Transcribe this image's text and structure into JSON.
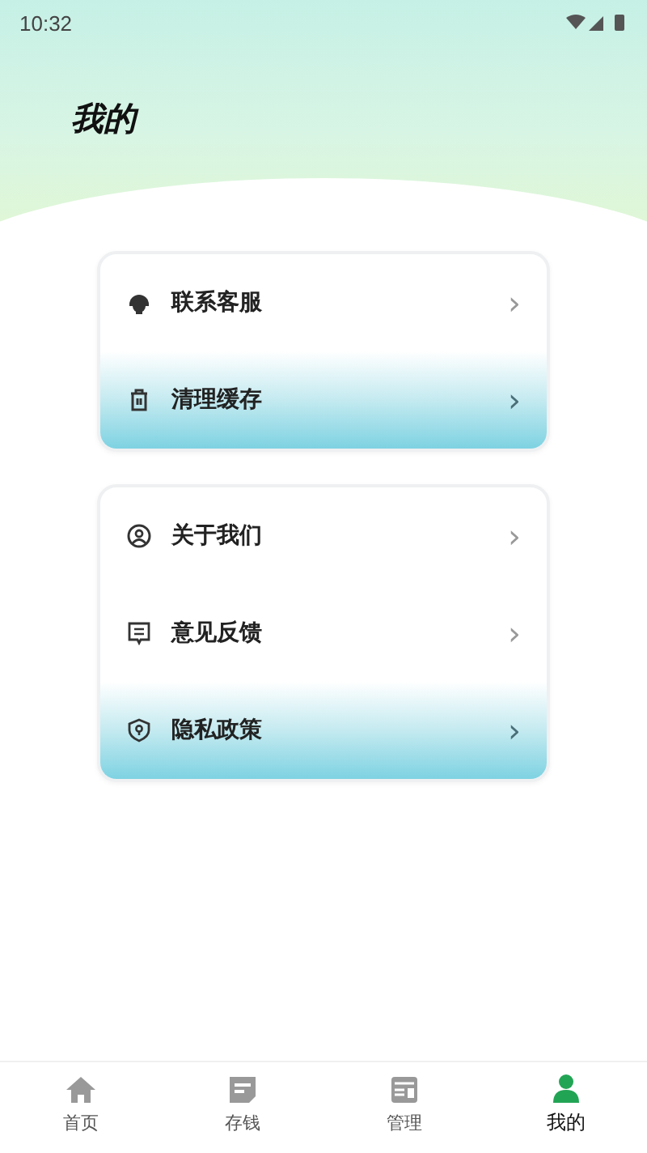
{
  "status_bar": {
    "time": "10:32"
  },
  "header": {
    "title": "我的"
  },
  "menu_groups": [
    {
      "items": [
        {
          "label": "联系客服",
          "chevron": "›",
          "highlighted": false
        },
        {
          "label": "清理缓存",
          "chevron": "›",
          "highlighted": true
        }
      ]
    },
    {
      "items": [
        {
          "label": "关于我们",
          "chevron": "›",
          "highlighted": false
        },
        {
          "label": "意见反馈",
          "chevron": "›",
          "highlighted": false
        },
        {
          "label": "隐私政策",
          "chevron": "›",
          "highlighted": true
        }
      ]
    }
  ],
  "bottom_nav": [
    {
      "label": "首页",
      "selected": false
    },
    {
      "label": "存钱",
      "selected": false
    },
    {
      "label": "管理",
      "selected": false
    },
    {
      "label": "我的",
      "selected": true
    }
  ]
}
